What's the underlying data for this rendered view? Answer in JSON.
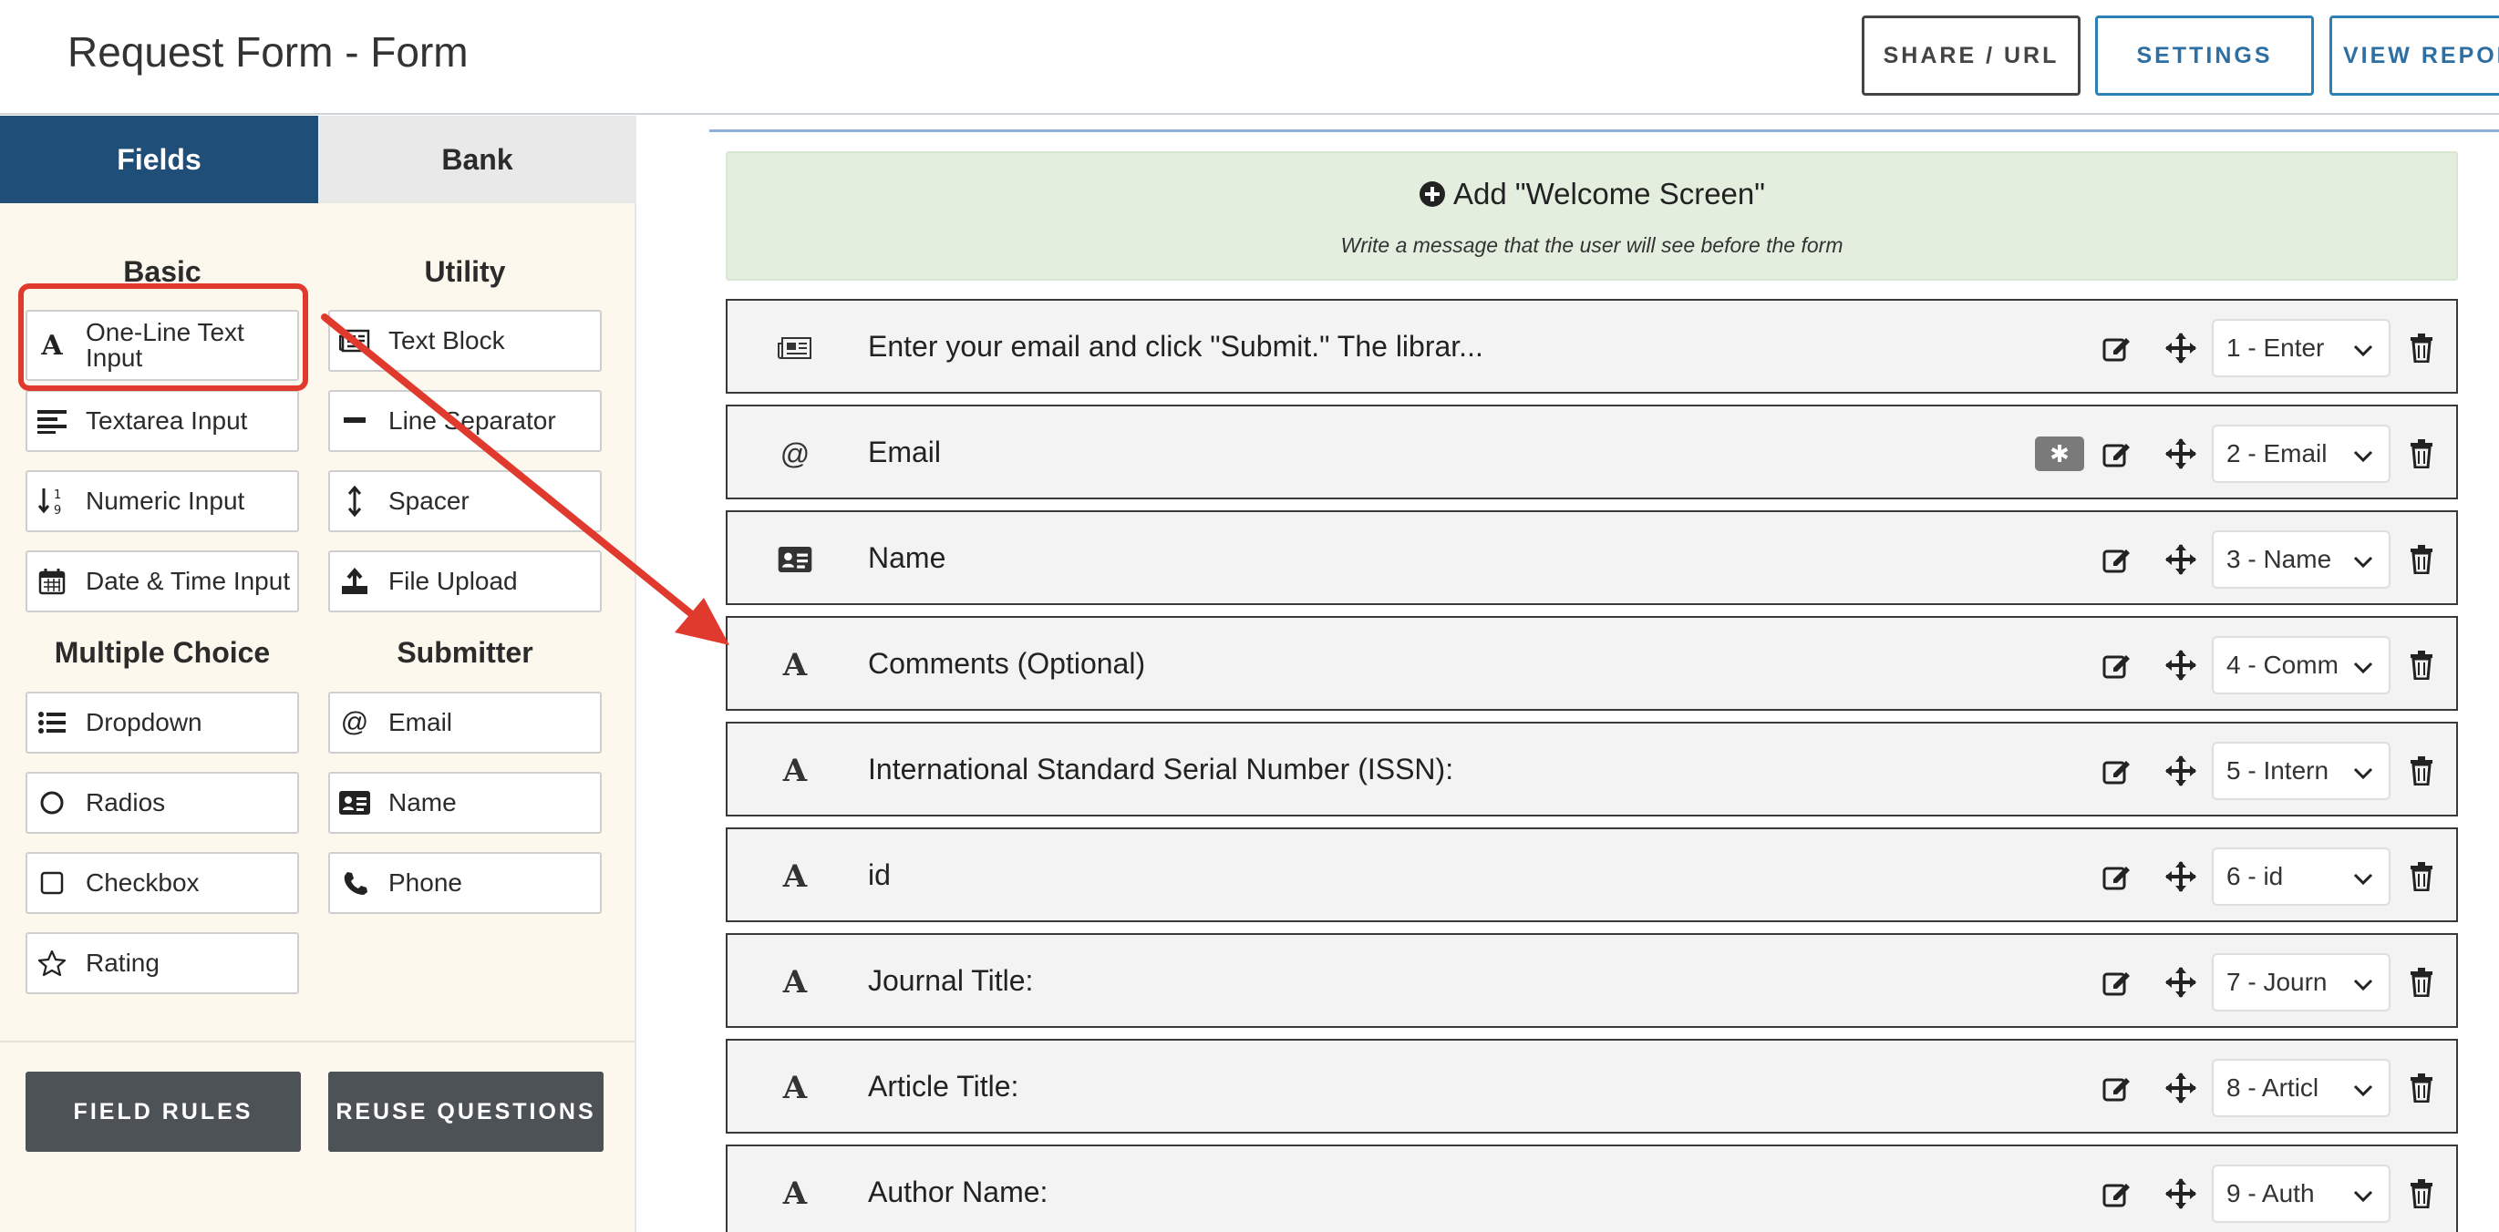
{
  "header": {
    "title": "Request Form - Form",
    "buttons": {
      "share": "SHARE / URL",
      "settings": "SETTINGS",
      "view_report": "VIEW REPOR"
    }
  },
  "sidebar": {
    "tabs": {
      "fields": "Fields",
      "bank": "Bank"
    },
    "sections": {
      "basic": "Basic",
      "utility": "Utility",
      "multiple_choice": "Multiple Choice",
      "submitter": "Submitter"
    },
    "basic": [
      {
        "label": "One-Line Text Input",
        "icon": "letter-a-icon"
      },
      {
        "label": "Textarea Input",
        "icon": "align-left-icon"
      },
      {
        "label": "Numeric Input",
        "icon": "sort-numeric-icon"
      },
      {
        "label": "Date & Time Input",
        "icon": "calendar-icon"
      }
    ],
    "utility": [
      {
        "label": "Text Block",
        "icon": "newspaper-icon"
      },
      {
        "label": "Line Separator",
        "icon": "minus-icon"
      },
      {
        "label": "Spacer",
        "icon": "vertical-arrows-icon"
      },
      {
        "label": "File Upload",
        "icon": "upload-icon"
      }
    ],
    "multiple_choice": [
      {
        "label": "Dropdown",
        "icon": "list-icon"
      },
      {
        "label": "Radios",
        "icon": "circle-icon"
      },
      {
        "label": "Checkbox",
        "icon": "square-icon"
      },
      {
        "label": "Rating",
        "icon": "star-icon"
      }
    ],
    "submitter": [
      {
        "label": "Email",
        "icon": "at-icon"
      },
      {
        "label": "Name",
        "icon": "id-card-icon"
      },
      {
        "label": "Phone",
        "icon": "phone-icon"
      }
    ],
    "buttons": {
      "field_rules": "FIELD RULES",
      "reuse_questions": "REUSE QUESTIONS"
    }
  },
  "main": {
    "welcome": {
      "title": "Add \"Welcome Screen\"",
      "subtitle": "Write a message that the user will see before the form"
    },
    "required_mark": "✱",
    "fields": [
      {
        "label": "Enter your email and click \"Submit.\" The librar...",
        "icon": "newspaper-icon",
        "order": "1 - Enter",
        "required": false
      },
      {
        "label": "Email",
        "icon": "at-icon",
        "order": "2 - Email",
        "required": true
      },
      {
        "label": "Name",
        "icon": "id-card-icon",
        "order": "3 - Name",
        "required": false
      },
      {
        "label": "Comments (Optional)",
        "icon": "letter-a-icon",
        "order": "4 - Comm",
        "required": false
      },
      {
        "label": "International Standard Serial Number (ISSN):",
        "icon": "letter-a-icon",
        "order": "5 - Intern",
        "required": false
      },
      {
        "label": "id",
        "icon": "letter-a-icon",
        "order": "6 - id",
        "required": false
      },
      {
        "label": "Journal Title:",
        "icon": "letter-a-icon",
        "order": "7 - Journ",
        "required": false
      },
      {
        "label": "Article Title:",
        "icon": "letter-a-icon",
        "order": "8 - Articl",
        "required": false
      },
      {
        "label": "Author Name:",
        "icon": "letter-a-icon",
        "order": "9 - Auth",
        "required": false
      }
    ]
  },
  "colors": {
    "primary_tab": "#1f4e79",
    "accent": "#2d7fb8",
    "annotation": "#e03a2e",
    "welcome_bg": "#e3eedf"
  }
}
